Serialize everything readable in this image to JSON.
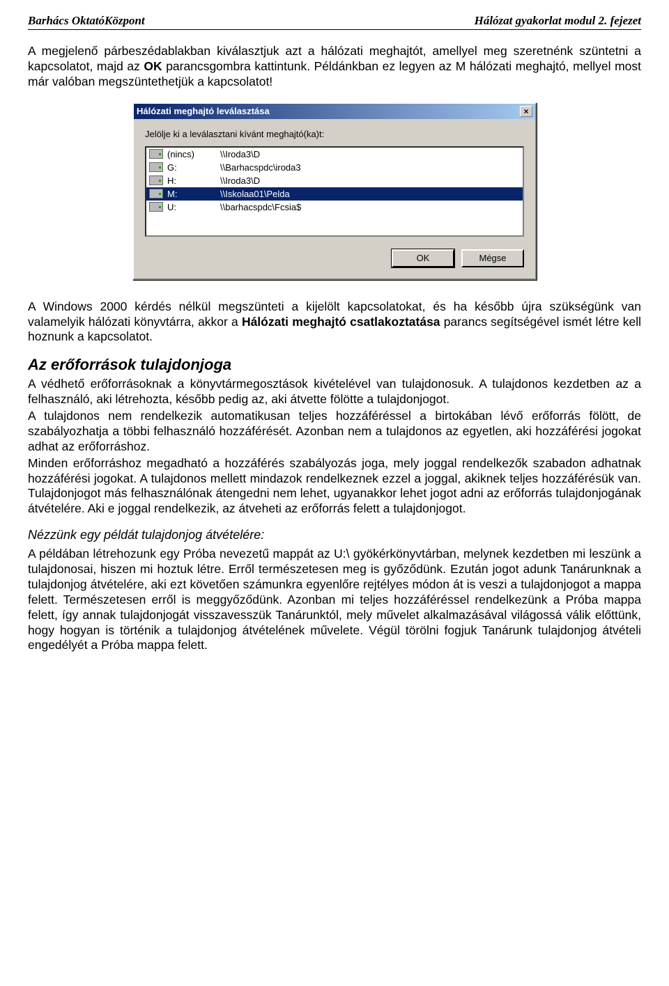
{
  "header": {
    "left": "Barhács OktatóKözpont",
    "right": "Hálózat gyakorlat modul 2. fejezet"
  },
  "intro": {
    "p1_a": "A megjelenő párbeszédablakban kiválasztjuk azt a hálózati meghajtót, amellyel meg szeretnénk szüntetni a kapcsolatot, majd az ",
    "p1_bold": "OK",
    "p1_b": " parancsgombra kattintunk. Példánkban ez legyen az M hálózati meghajtó, mellyel most már valóban megszüntethetjük a kapcsolatot!"
  },
  "dialog": {
    "title": "Hálózati meghajtó leválasztása",
    "close_glyph": "×",
    "instruction": "Jelölje ki a leválasztani kívánt meghajtó(ka)t:",
    "items": [
      {
        "letter": "(nincs)",
        "path": "\\\\Iroda3\\D",
        "selected": false
      },
      {
        "letter": "G:",
        "path": "\\\\Barhacspdc\\iroda3",
        "selected": false
      },
      {
        "letter": "H:",
        "path": "\\\\Iroda3\\D",
        "selected": false
      },
      {
        "letter": "M:",
        "path": "\\\\Iskolaa01\\Pelda",
        "selected": true
      },
      {
        "letter": "U:",
        "path": "\\\\barhacspdc\\Fcsia$",
        "selected": false
      }
    ],
    "ok": "OK",
    "cancel": "Mégse"
  },
  "after_dialog": {
    "p_a": "A Windows 2000 kérdés nélkül megszünteti a kijelölt kapcsolatokat, és ha később újra szükségünk van valamelyik hálózati könyvtárra, akkor a ",
    "p_bold": "Hálózati meghajtó csatlakoztatása",
    "p_b": " parancs segítségével ismét létre kell hoznunk a kapcsolatot."
  },
  "section": {
    "title": "Az erőforrások tulajdonjoga",
    "p1": "A védhető erőforrásoknak a könyvtármegosztások kivételével van tulajdonosuk. A tulajdonos kezdetben az a felhasználó, aki létrehozta, később pedig az, aki átvette fölötte a tulajdonjogot.",
    "p2": "A tulajdonos nem rendelkezik automatikusan teljes hozzáféréssel a birtokában lévő erőforrás fölött, de szabályozhatja a többi felhasználó hozzáférését. Azonban nem a tulajdonos az egyetlen, aki hozzáférési jogokat adhat az erőforráshoz.",
    "p3": "Minden erőforráshoz megadható a hozzáférés szabályozás joga, mely joggal rendelkezők szabadon adhatnak hozzáférési jogokat. A tulajdonos mellett mindazok rendelkeznek ezzel a joggal, akiknek teljes hozzáférésük van. Tulajdonjogot más felhasználónak átengedni nem lehet, ugyanakkor lehet jogot adni az erőforrás tulajdonjogának átvételére. Aki e joggal rendelkezik, az átveheti az erőforrás felett a tulajdonjogot."
  },
  "example": {
    "heading": "Nézzünk egy példát tulajdonjog átvételére:",
    "p": "A példában létrehozunk egy Próba nevezetű mappát az U:\\ gyökérkönyvtárban, melynek kezdetben mi leszünk a tulajdonosai, hiszen mi hoztuk létre. Erről természetesen meg is győződünk. Ezután jogot adunk Tanárunknak a tulajdonjog átvételére, aki ezt követően számunkra egyenlőre rejtélyes módon át is veszi a tulajdonjogot a mappa felett. Természetesen erről is meggyőződünk. Azonban mi teljes hozzáféréssel rendelkezünk a Próba mappa felett, így annak tulajdonjogát visszavesszük Tanárunktól, mely művelet alkalmazásával világossá válik előttünk, hogy hogyan is történik a tulajdonjog átvételének művelete. Végül törölni fogjuk Tanárunk tulajdonjog átvételi engedélyét a Próba mappa felett."
  }
}
